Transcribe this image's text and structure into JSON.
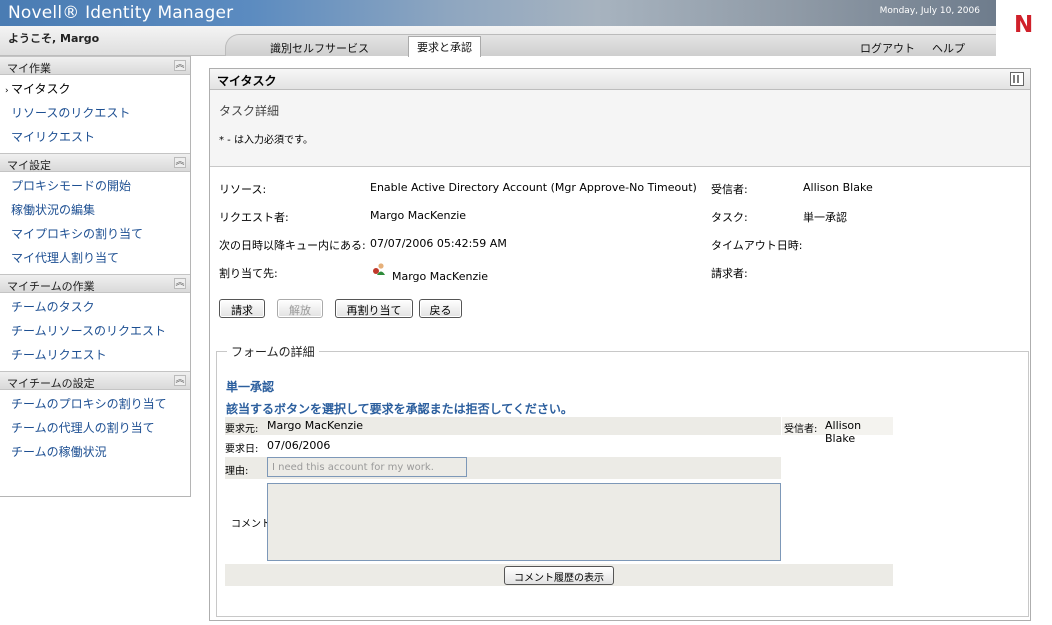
{
  "header": {
    "brand": "Novell® Identity Manager",
    "date": "Monday, July 10, 2006",
    "logo_letter": "N",
    "welcome": "ようこそ, Margo"
  },
  "tabs": {
    "self_service": "識別セルフサービス",
    "requests": "要求と承認",
    "logout": "ログアウト",
    "help": "ヘルプ"
  },
  "sidebar": {
    "sections": [
      {
        "title": "マイ作業",
        "items": [
          "マイタスク",
          "リソースのリクエスト",
          "マイリクエスト"
        ]
      },
      {
        "title": "マイ設定",
        "items": [
          "プロキシモードの開始",
          "稼働状況の編集",
          "マイプロキシの割り当て",
          "マイ代理人割り当て"
        ]
      },
      {
        "title": "マイチームの作業",
        "items": [
          "チームのタスク",
          "チームリソースのリクエスト",
          "チームリクエスト"
        ]
      },
      {
        "title": "マイチームの設定",
        "items": [
          "チームのプロキシの割り当て",
          "チームの代理人の割り当て",
          "チームの稼働状況"
        ]
      }
    ],
    "active_item": "マイタスク"
  },
  "panel": {
    "title": "マイタスク",
    "task_detail": "タスク詳細",
    "required_note": "* - は入力必須です。"
  },
  "task": {
    "resource_label": "リソース:",
    "resource_value": "Enable Active Directory Account (Mgr Approve-No Timeout)",
    "requester_label": "リクエスト者:",
    "requester_value": "Margo MacKenzie",
    "queued_label": "次の日時以降キュー内にある:",
    "queued_value": "07/07/2006 05:42:59 AM",
    "assigned_label": "割り当て先:",
    "assigned_value": "Margo MacKenzie",
    "recipient_label": "受信者:",
    "recipient_value": "Allison Blake",
    "task_label": "タスク:",
    "task_value": "単一承認",
    "timeout_label": "タイムアウト日時:",
    "timeout_value": "",
    "claimant_label": "請求者:",
    "claimant_value": ""
  },
  "buttons": {
    "claim": "請求",
    "release": "解放",
    "reassign": "再割り当て",
    "back": "戻る"
  },
  "form": {
    "legend": "フォームの詳細",
    "title": "単一承認",
    "instruction": "該当するボタンを選択して要求を承認または拒否してください。",
    "requested_by_label": "要求元:",
    "requested_by_value": "Margo MacKenzie",
    "recipient_label": "受信者:",
    "recipient_value": "Allison Blake",
    "request_date_label": "要求日:",
    "request_date_value": "07/06/2006",
    "reason_label": "理由:",
    "reason_value": "I need this account for my work.",
    "comment_label": "コメント:",
    "history_button": "コメント履歴の表示"
  }
}
